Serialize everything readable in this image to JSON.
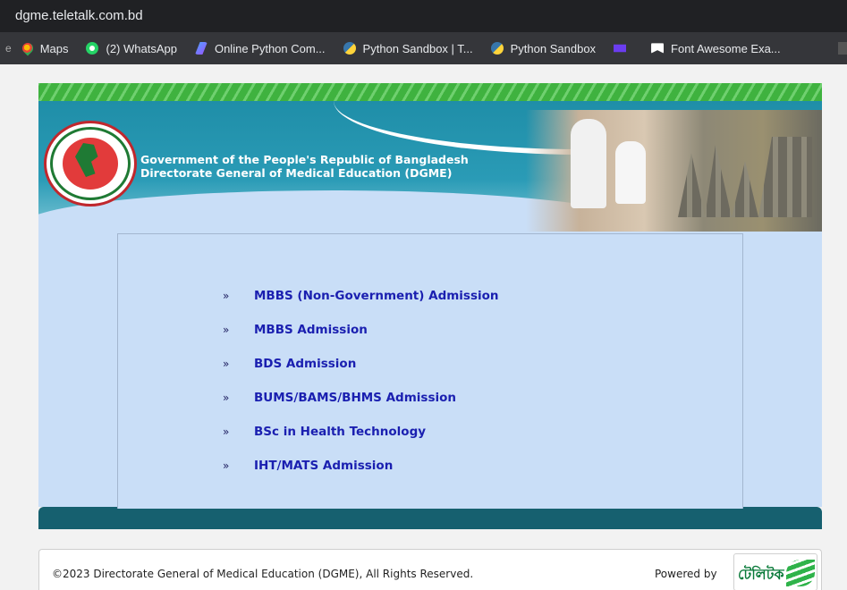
{
  "browser": {
    "url": "dgme.teletalk.com.bd",
    "bookmarks_left_fragment": "e",
    "bookmarks": [
      {
        "label": "Maps",
        "icon": "maps-icon"
      },
      {
        "label": "(2) WhatsApp",
        "icon": "whatsapp-icon"
      },
      {
        "label": "Online Python Com...",
        "icon": "online-python-icon"
      },
      {
        "label": "Python Sandbox | T...",
        "icon": "python-icon"
      },
      {
        "label": "Python Sandbox",
        "icon": "python-icon"
      },
      {
        "label": "",
        "icon": "mail-icon"
      },
      {
        "label": "Font Awesome Exa...",
        "icon": "font-awesome-icon"
      }
    ]
  },
  "header": {
    "line1": "Government of the People's Republic of Bangladesh",
    "line2": "Directorate General of Medical Education (DGME)"
  },
  "menu": {
    "bullet": "»",
    "items": [
      {
        "label": "MBBS (Non-Government) Admission"
      },
      {
        "label": "MBBS Admission"
      },
      {
        "label": "BDS Admission"
      },
      {
        "label": "BUMS/BAMS/BHMS Admission"
      },
      {
        "label": "BSc in Health Technology"
      },
      {
        "label": "IHT/MATS Admission"
      }
    ]
  },
  "footer": {
    "copyright": "©2023 Directorate General of Medical Education (DGME), All Rights Reserved.",
    "powered_by": "Powered by",
    "logo_text": "টেলিটক"
  },
  "colors": {
    "link": "#1a1fb0",
    "content_bg": "#c9def7",
    "teal_bar": "#16606f",
    "banner": "#2a9bb6",
    "green_stripe": "#3fb23f"
  }
}
